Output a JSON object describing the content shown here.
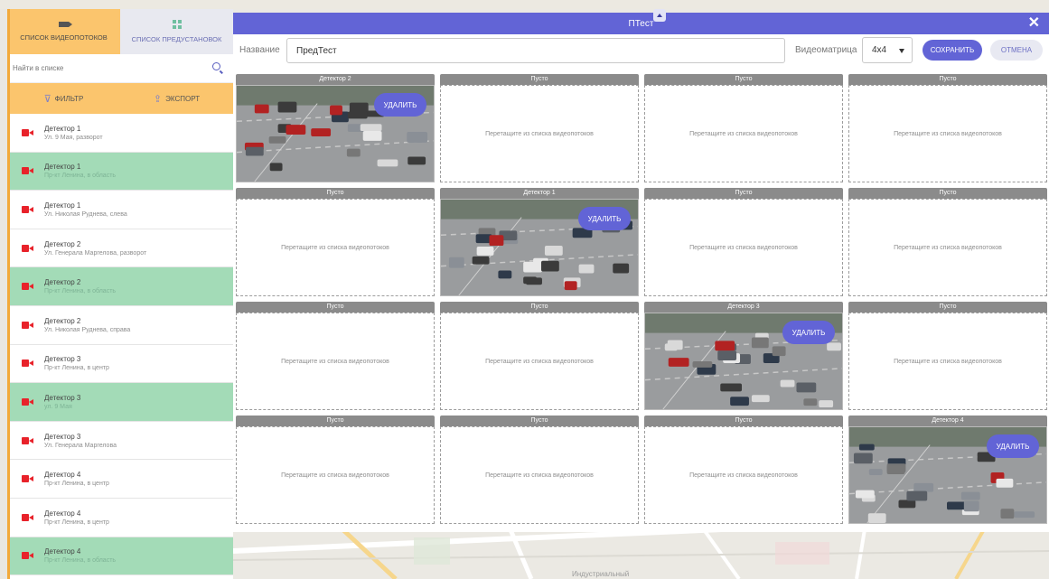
{
  "sidebar": {
    "tabs": [
      {
        "label": "список видеопотоков",
        "icon": "video-camera-icon"
      },
      {
        "label": "список предустановок",
        "icon": "grid-icon"
      }
    ],
    "search": {
      "placeholder": "Найти в списке"
    },
    "actions": {
      "filter_label": "фильтр",
      "export_label": "экспорт"
    },
    "streams": [
      {
        "title": "Детектор 1",
        "subtitle": "Ул. 9 Мая, разворот",
        "highlighted": false
      },
      {
        "title": "Детектор 1",
        "subtitle": "Пр-кт Ленина, в область",
        "highlighted": true
      },
      {
        "title": "Детектор 1",
        "subtitle": "Ул. Николая Руднева, слева",
        "highlighted": false
      },
      {
        "title": "Детектор 2",
        "subtitle": "Ул. Генерала Маргелова, разворот",
        "highlighted": false
      },
      {
        "title": "Детектор 2",
        "subtitle": "Пр-кт Ленина, в область",
        "highlighted": true
      },
      {
        "title": "Детектор 2",
        "subtitle": "Ул. Николая Руднева, справа",
        "highlighted": false
      },
      {
        "title": "Детектор 3",
        "subtitle": "Пр-кт Ленина, в центр",
        "highlighted": false
      },
      {
        "title": "Детектор 3",
        "subtitle": "ул. 9 Мая",
        "highlighted": true
      },
      {
        "title": "Детектор 3",
        "subtitle": "Ул. Генерала Маргелова",
        "highlighted": false
      },
      {
        "title": "Детектор 4",
        "subtitle": "Пр-кт Ленина, в центр",
        "highlighted": false
      },
      {
        "title": "Детектор 4",
        "subtitle": "Пр-кт Ленина, в центр",
        "highlighted": false
      },
      {
        "title": "Детектор 4",
        "subtitle": "Пр-кт Ленина, в область",
        "highlighted": true
      }
    ]
  },
  "modal": {
    "title": "ПТест",
    "name_label": "Название",
    "name_value": "ПредТест",
    "matrix_label": "Видеоматрица",
    "matrix_value": "4x4",
    "save_label": "сохранить",
    "cancel_label": "отмена",
    "delete_label": "удалить",
    "empty_hint": "Перетащите из списка видеопотоков",
    "cells": [
      {
        "title": "Детектор 2",
        "has_video": true
      },
      {
        "title": "Пусто",
        "has_video": false
      },
      {
        "title": "Пусто",
        "has_video": false
      },
      {
        "title": "Пусто",
        "has_video": false
      },
      {
        "title": "Пусто",
        "has_video": false
      },
      {
        "title": "Детектор 1",
        "has_video": true
      },
      {
        "title": "Пусто",
        "has_video": false
      },
      {
        "title": "Пусто",
        "has_video": false
      },
      {
        "title": "Пусто",
        "has_video": false
      },
      {
        "title": "Пусто",
        "has_video": false
      },
      {
        "title": "Детектор 3",
        "has_video": true
      },
      {
        "title": "Пусто",
        "has_video": false
      },
      {
        "title": "Пусто",
        "has_video": false
      },
      {
        "title": "Пусто",
        "has_video": false
      },
      {
        "title": "Пусто",
        "has_video": false
      },
      {
        "title": "Детектор 4",
        "has_video": true
      }
    ]
  },
  "colors": {
    "accent": "#6264d6",
    "sidebar_active": "#fbc56d",
    "highlight_row": "#a3dbb7",
    "camera_red": "#e8222a"
  },
  "map": {
    "street_label": "Индустриальный"
  }
}
